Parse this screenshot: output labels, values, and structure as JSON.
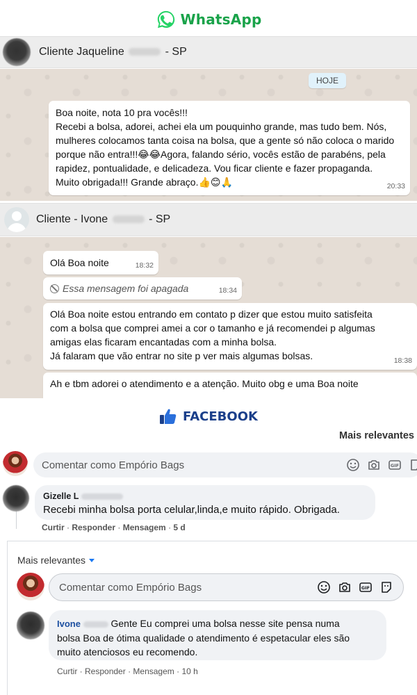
{
  "whatsapp_brand": {
    "title": "WhatsApp",
    "color": "#1aa34a"
  },
  "chat1": {
    "contact_name_prefix": "Cliente Jaqueline",
    "contact_name_suffix": "- SP",
    "date_chip": "HOJE",
    "message": {
      "text": "Boa noite, nota 10 pra vocês!!!\nRecebi a bolsa, adorei, achei ela um pouquinho grande, mas tudo bem. Nós,\nmulheres colocamos tanta coisa na bolsa, que a gente só não coloca o marido\nporque não entra!!!😂😂Agora, falando sério, vocês estão de parabéns, pela\nrapidez, pontualidade, e delicadeza. Vou ficar cliente e fazer propaganda.\nMuito obrigada!!! Grande abraço.👍😊🙏",
      "time": "20:33"
    }
  },
  "chat2": {
    "contact_name_prefix": "Cliente - Ivone",
    "contact_name_suffix": "- SP",
    "messages": [
      {
        "text": "Olá Boa noite",
        "time": "18:32"
      },
      {
        "text": "Essa mensagem foi apagada",
        "time": "18:34",
        "deleted": true
      },
      {
        "text": "Olá Boa noite estou entrando em contato p dizer que estou muito satisfeita\ncom a bolsa que comprei  amei a cor o tamanho e já recomendei p algumas\namigas elas ficaram encantadas com a  minha bolsa.\nJá falaram que vão entrar no site p ver mais algumas bolsas.",
        "time": "18:38"
      },
      {
        "text": "Ah e tbm adorei o atendimento e a atenção. Muito obg e uma Boa noite"
      }
    ]
  },
  "facebook_brand": {
    "title": "FACEBOOK",
    "color": "#1b3f8a"
  },
  "fb_section1": {
    "sort_label": "Mais relevantes",
    "comment_placeholder": "Comentar como Empório Bags",
    "comment": {
      "author_visible": "Gizelle L",
      "text": "Recebi minha bolsa porta celular,linda,e muito rápido. Obrigada.",
      "actions": [
        "Curtir",
        "Responder",
        "Mensagem"
      ],
      "age": "5 d"
    }
  },
  "fb_section2": {
    "sort_label": "Mais relevantes",
    "comment_placeholder": "Comentar como Empório Bags",
    "comment": {
      "author_visible": "Ivone",
      "text_first_line": "Gente Eu comprei uma bolsa nesse site pensa numa",
      "text_rest": "bolsa Boa de ótima qualidade o atendimento é espetacular eles são\nmuito atenciosos eu recomendo.",
      "actions": [
        "Curtir",
        "Responder",
        "Mensagem"
      ],
      "age": "10 h"
    }
  },
  "icons": [
    "whatsapp-logo-icon",
    "ban-icon",
    "thumbs-up-icon",
    "smiley-icon",
    "camera-icon",
    "gif-icon",
    "sticker-icon",
    "caret-down-icon"
  ]
}
